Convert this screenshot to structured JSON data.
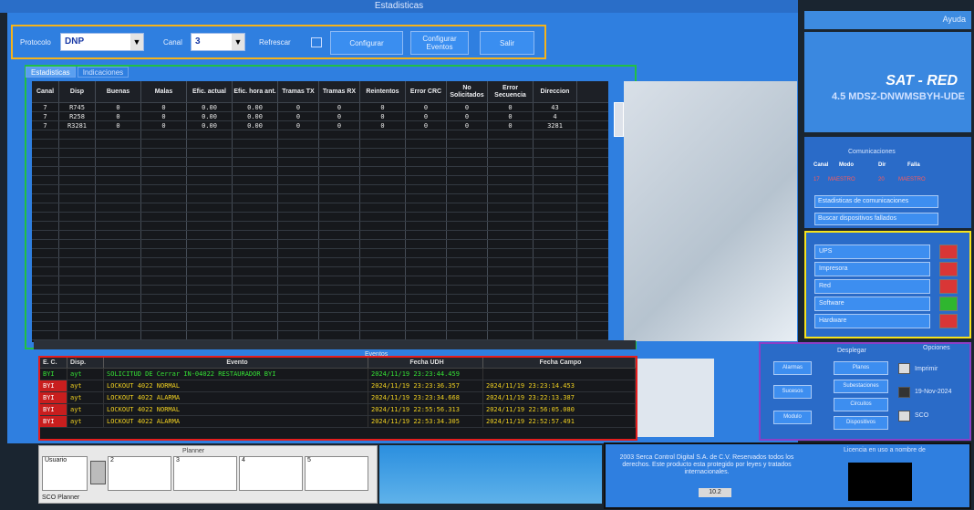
{
  "window": {
    "title": "Estadisticas",
    "right_title": "Ayuda"
  },
  "toolbar": {
    "protocolo_label": "Protocolo",
    "protocolo_value": "DNP",
    "canal_label": "Canal",
    "canal_value": "3",
    "autorefresh_label": "Refrescar",
    "configurar_label": "Configurar",
    "configurar_eventos_label": "Configurar Eventos",
    "salir_label": "Salir"
  },
  "tabs": [
    "Estadisticas",
    "Indicaciones"
  ],
  "stats": {
    "columns": [
      "Canal",
      "Disp",
      "Buenas",
      "Malas",
      "Efic. actual",
      "Efic. hora ant.",
      "Tramas TX",
      "Tramas RX",
      "Reintentos",
      "Error CRC",
      "No Solicitados",
      "Error Secuencia",
      "Direccion"
    ],
    "rows": [
      [
        "7",
        "R745",
        "0",
        "0",
        "0.00",
        "0.00",
        "0",
        "0",
        "0",
        "0",
        "0",
        "0",
        "43"
      ],
      [
        "7",
        "R258",
        "0",
        "0",
        "0.00",
        "0.00",
        "0",
        "0",
        "0",
        "0",
        "0",
        "0",
        "4"
      ],
      [
        "7",
        "R3281",
        "0",
        "0",
        "0.00",
        "0.00",
        "0",
        "0",
        "0",
        "0",
        "0",
        "0",
        "3281"
      ]
    ]
  },
  "events": {
    "title": "Eventos",
    "columns": [
      "E. C.",
      "Disp.",
      "Evento",
      "Fecha UDH",
      "Fecha Campo"
    ],
    "rows": [
      {
        "ec": "BYI",
        "disp": "ayt",
        "evento": "SOLICITUD DE Cerrar IN-04022 RESTAURADOR BYI",
        "fecha_udh": "2024/11/19 23:23:44.459",
        "fecha_campo": "",
        "color": "#35e035"
      },
      {
        "ec": "BYI",
        "disp": "ayt",
        "evento": "LOCKOUT 4022    NORMAL",
        "fecha_udh": "2024/11/19 23:23:36.357",
        "fecha_campo": "2024/11/19 23:23:14.453",
        "color": "#f0d020"
      },
      {
        "ec": "BYI",
        "disp": "ayt",
        "evento": "LOCKOUT 4022    ALARMA",
        "fecha_udh": "2024/11/19 23:23:34.668",
        "fecha_campo": "2024/11/19 23:22:13.387",
        "color": "#f0d020"
      },
      {
        "ec": "BYI",
        "disp": "ayt",
        "evento": "LOCKOUT 4022    NORMAL",
        "fecha_udh": "2024/11/19 22:55:56.313",
        "fecha_campo": "2024/11/19 22:56:05.080",
        "color": "#f0d020"
      },
      {
        "ec": "BYI",
        "disp": "ayt",
        "evento": "LOCKOUT 4022    ALARMA",
        "fecha_udh": "2024/11/19 22:53:34.305",
        "fecha_campo": "2024/11/19 22:52:57.491",
        "color": "#f0d020"
      }
    ]
  },
  "sat": {
    "title": "SAT - RED",
    "subtitle": "4.5 MDSZ-DNWMSBYH-UDE"
  },
  "comunicaciones": {
    "title": "Comunicaciones",
    "headers": [
      "Canal",
      "Modo",
      "Dir",
      "Falla"
    ],
    "values": [
      "17",
      "MAESTRO",
      "20",
      "MAESTRO"
    ],
    "btn_estadisticas": "Estadisticas de comunicaciones",
    "btn_buscar": "Buscar dispositivos fallados"
  },
  "status": {
    "items": [
      {
        "label": "UPS",
        "light": "#d93636"
      },
      {
        "label": "Impresora",
        "light": "#d93636"
      },
      {
        "label": "Red",
        "light": "#d93636"
      },
      {
        "label": "Software",
        "light": "#2fb62f"
      },
      {
        "label": "Hardware",
        "light": "#d93636"
      }
    ]
  },
  "desplegar": {
    "title": "Desplegar",
    "opciones_title": "Opciones",
    "btn_alarmas": "Alarmas",
    "btn_sucesos": "Sucesos",
    "btn_modulo": "Modulo",
    "btn_planos": "Planos",
    "btn_subestaciones": "Subestaciones",
    "btn_circuitos": "Circuitos",
    "btn_dispositivos": "Dispositivos",
    "opt1": "Imprimir",
    "opt2": "19-Nov-2024",
    "opt3": "SCO"
  },
  "planner": {
    "title": "Planner",
    "label": "SCO Planner",
    "cells": [
      "Usuario",
      "2",
      "3",
      "4",
      "5"
    ]
  },
  "copyright": {
    "text": "2003 Serca Control Digital S.A. de C.V. Reservados todos los derechos. Este producto esta protegido por leyes y tratados internacionales.",
    "license_text": "Licencia en uso a nombre de",
    "version": "10.2"
  }
}
